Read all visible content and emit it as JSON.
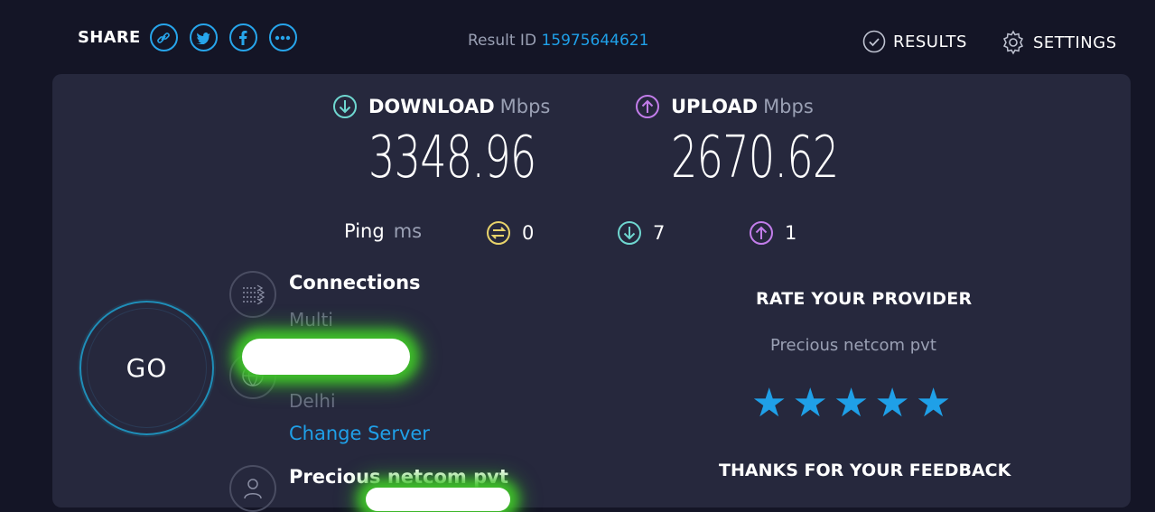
{
  "header": {
    "share_label": "SHARE",
    "share_icons": [
      "link-icon",
      "twitter-icon",
      "facebook-icon",
      "more-icon"
    ],
    "result_id_label": "Result ID",
    "result_id_value": "15975644621",
    "results_label": "RESULTS",
    "settings_label": "SETTINGS"
  },
  "download": {
    "label": "DOWNLOAD",
    "unit": "Mbps",
    "value": "3348.96",
    "color": "#6fd7d0"
  },
  "upload": {
    "label": "UPLOAD",
    "unit": "Mbps",
    "value": "2670.62",
    "color": "#c27dea"
  },
  "ping": {
    "label": "Ping",
    "unit": "ms",
    "idle": "0",
    "download": "7",
    "upload": "1",
    "idle_color": "#e8d36b"
  },
  "go_label": "GO",
  "connections": {
    "title": "Connections",
    "value": "Multi"
  },
  "server": {
    "location": "Delhi",
    "change_label": "Change Server"
  },
  "provider": {
    "name": "Precious netcom pvt"
  },
  "rating": {
    "title": "RATE YOUR PROVIDER",
    "provider": "Precious netcom pvt",
    "stars": 5,
    "max_stars": 5,
    "feedback": "THANKS FOR YOUR FEEDBACK"
  },
  "colors": {
    "accent": "#1fa0e8",
    "background": "#141526",
    "panel": "#26283d"
  }
}
